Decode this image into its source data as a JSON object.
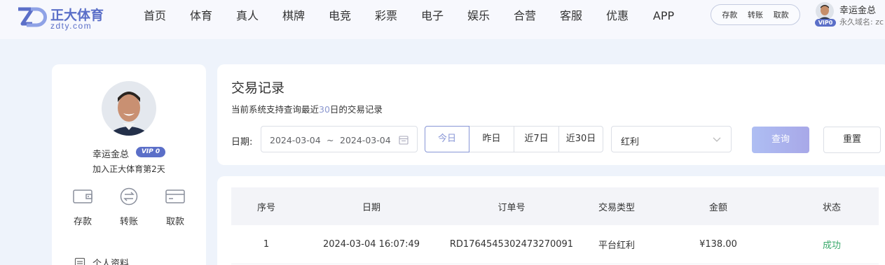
{
  "brand": {
    "title": "正大体育",
    "subtitle": "zdty.com",
    "mark_text": "ZD"
  },
  "nav": [
    "首页",
    "体育",
    "真人",
    "棋牌",
    "电竞",
    "彩票",
    "电子",
    "娱乐",
    "合营",
    "客服",
    "优惠",
    "APP"
  ],
  "quick_actions": [
    "存款",
    "转账",
    "取款"
  ],
  "header_user": {
    "name": "幸运金总",
    "vip": "VIP0",
    "domain_label": "永久域名: zc"
  },
  "profile": {
    "name": "幸运金总",
    "vip": "VIP 0",
    "days": "加入正大体育第2天",
    "actions": [
      {
        "label": "存款",
        "icon": "wallet-icon"
      },
      {
        "label": "转账",
        "icon": "transfer-icon"
      },
      {
        "label": "取款",
        "icon": "card-icon"
      }
    ],
    "menu_first": "个人资料"
  },
  "filter": {
    "title": "交易记录",
    "subtitle_prefix": "当前系统支持查询最近",
    "subtitle_days": "30",
    "subtitle_suffix": "日的交易记录",
    "date_label": "日期:",
    "date_start": "2024-03-04",
    "date_sep": "~",
    "date_end": "2024-03-04",
    "quick_dates": [
      "今日",
      "昨日",
      "近7日",
      "近30日"
    ],
    "active_quick_date": "今日",
    "type_value": "红利",
    "query_label": "查询",
    "reset_label": "重置"
  },
  "table": {
    "columns": [
      "序号",
      "日期",
      "订单号",
      "交易类型",
      "金额",
      "状态"
    ],
    "rows": [
      [
        "1",
        "2024-03-04 16:07:49",
        "RD1764545302473270091",
        "平台红利",
        "¥138.00",
        "成功"
      ]
    ]
  },
  "colors": {
    "accent": "#5b6fc8",
    "success": "#3aa96b",
    "page_bg": "#eef3fb"
  }
}
